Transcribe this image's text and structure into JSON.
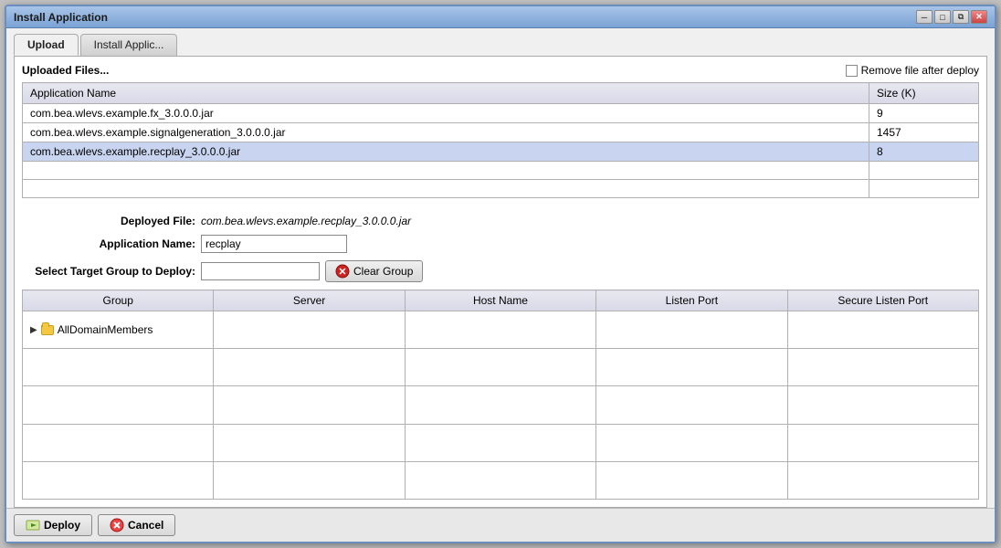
{
  "window": {
    "title": "Install Application",
    "controls": [
      "minimize",
      "maximize",
      "restore",
      "close"
    ]
  },
  "tabs": [
    {
      "label": "Upload",
      "active": true
    },
    {
      "label": "Install Applic...",
      "active": false
    }
  ],
  "uploaded_files": {
    "heading": "Uploaded Files...",
    "remove_after_deploy_label": "Remove file after deploy",
    "table_headers": [
      "Application Name",
      "Size (K)"
    ],
    "rows": [
      {
        "name": "com.bea.wlevs.example.fx_3.0.0.0.jar",
        "size": "9",
        "selected": false
      },
      {
        "name": "com.bea.wlevs.example.signalgeneration_3.0.0.0.jar",
        "size": "1457",
        "selected": false
      },
      {
        "name": "com.bea.wlevs.example.recplay_3.0.0.0.jar",
        "size": "8",
        "selected": true
      },
      {
        "name": "",
        "size": "",
        "selected": false
      },
      {
        "name": "",
        "size": "",
        "selected": false
      }
    ]
  },
  "form": {
    "deployed_file_label": "Deployed File:",
    "deployed_file_value": "com.bea.wlevs.example.recplay_3.0.0.0.jar",
    "application_name_label": "Application Name:",
    "application_name_value": "recplay",
    "select_target_label": "Select Target Group to Deploy:",
    "select_target_value": "",
    "clear_group_label": "Clear Group"
  },
  "servers_table": {
    "headers": [
      "Group",
      "Server",
      "Host Name",
      "Listen Port",
      "Secure Listen Port"
    ],
    "rows": [
      {
        "group": "AllDomainMembers",
        "server": "",
        "host": "",
        "port": "",
        "secure_port": "",
        "expandable": true
      },
      {
        "group": "",
        "server": "",
        "host": "",
        "port": "",
        "secure_port": ""
      },
      {
        "group": "",
        "server": "",
        "host": "",
        "port": "",
        "secure_port": ""
      },
      {
        "group": "",
        "server": "",
        "host": "",
        "port": "",
        "secure_port": ""
      },
      {
        "group": "",
        "server": "",
        "host": "",
        "port": "",
        "secure_port": ""
      }
    ]
  },
  "footer": {
    "deploy_label": "Deploy",
    "cancel_label": "Cancel"
  }
}
